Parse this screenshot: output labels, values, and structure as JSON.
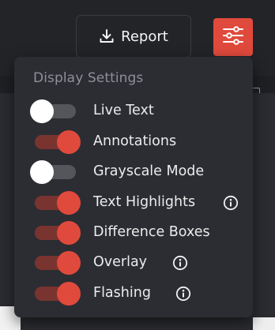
{
  "toolbar": {
    "report_label": "Report",
    "report_icon": "download-icon",
    "settings_icon": "sliders-icon",
    "accent_color": "#e04a3c"
  },
  "settings_panel": {
    "title": "Display Settings",
    "items": [
      {
        "label": "Live Text",
        "enabled": false,
        "has_info": false
      },
      {
        "label": "Annotations",
        "enabled": true,
        "has_info": false
      },
      {
        "label": "Grayscale Mode",
        "enabled": false,
        "has_info": false
      },
      {
        "label": "Text Highlights",
        "enabled": true,
        "has_info": true
      },
      {
        "label": "Difference Boxes",
        "enabled": true,
        "has_info": false
      },
      {
        "label": "Overlay",
        "enabled": true,
        "has_info": true
      },
      {
        "label": "Flashing",
        "enabled": true,
        "has_info": true
      }
    ]
  }
}
